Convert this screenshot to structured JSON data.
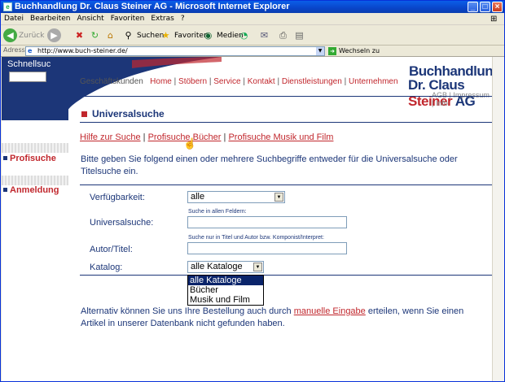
{
  "window": {
    "title": "Buchhandlung Dr. Claus Steiner AG - Microsoft Internet Explorer"
  },
  "menu": [
    "Datei",
    "Bearbeiten",
    "Ansicht",
    "Favoriten",
    "Extras",
    "?"
  ],
  "toolbar": {
    "back": "Zurück",
    "search": "Suchen",
    "favorites": "Favoriten",
    "media": "Medien"
  },
  "address": {
    "label": "Adresse",
    "url": "http://www.buch-steiner.de/",
    "go": "Wechseln zu"
  },
  "sidebar": {
    "quick": "Schnellsuche",
    "profisuche": "Profisuche",
    "anmeldung": "Anmeldung"
  },
  "topnav": {
    "first": "Geschäftskunden",
    "links": [
      "Home",
      "Stöbern",
      "Service",
      "Kontakt",
      "Dienstleistungen",
      "Unternehmen"
    ],
    "sep": "|"
  },
  "logo": {
    "line1": "Buchhandlung",
    "line2a": "Dr. Claus ",
    "line2b": "Steiner",
    "line2c": " AG",
    "reg": "®",
    "sub": "AGB | Impressum | Info"
  },
  "page": {
    "section": "Universalsuche",
    "links": {
      "a": "Hilfe zur Suche",
      "b": "Profisuche Bücher",
      "c": "Profisuche Musik und Film"
    },
    "intro": "Bitte geben Sie folgend einen oder mehrere Suchbegriffe entweder für die Universalsuche oder Titelsuche ein.",
    "form": {
      "verfuegbarkeit": {
        "label": "Verfügbarkeit:",
        "value": "alle"
      },
      "universal": {
        "label": "Universalsuche:",
        "hint": "Suche in allen Feldern:"
      },
      "autor": {
        "label": "Autor/Titel:",
        "hint": "Suche nur in Titel und Autor bzw. Komponist/Interpret:"
      },
      "katalog": {
        "label": "Katalog:",
        "value": "alle Kataloge",
        "options": [
          "alle Kataloge",
          "Bücher",
          "Musik und Film"
        ]
      }
    },
    "alt": {
      "pre": "Alternativ können Sie uns Ihre Bestellung auch durch ",
      "link": "manuelle Eingabe",
      "post": " erteilen, wenn Sie einen Artikel in unserer Datenbank nicht gefunden haben."
    }
  }
}
